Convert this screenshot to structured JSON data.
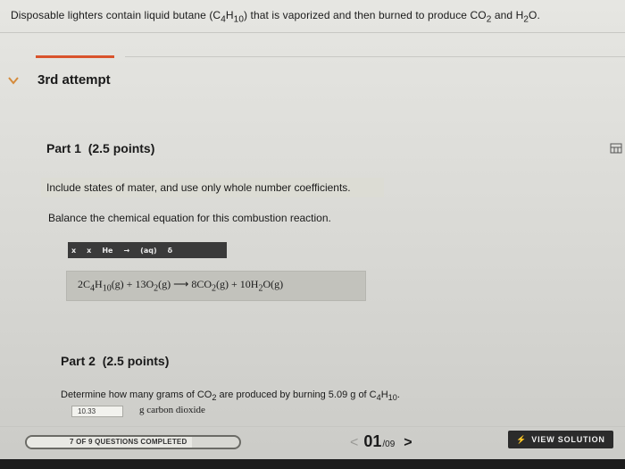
{
  "question": {
    "pre": "Disposable lighters contain liquid butane (C",
    "sub1": "4",
    "mid1": "H",
    "sub2": "10",
    "mid2": ") that is vaporized and then burned to produce CO",
    "sub3": "2",
    "mid3": " and H",
    "sub4": "2",
    "post": "O."
  },
  "attempt_label": "3rd attempt",
  "part1": {
    "title": "Part 1",
    "points": "(2.5 points)",
    "hint": "Include states of mater, and use only whole number coefficients.",
    "instruction": "Balance the chemical equation for this combustion reaction.",
    "toolbar": [
      "x",
      "x",
      "He",
      "→",
      "(aq)",
      "δ"
    ],
    "equation": {
      "t1": "2C",
      "s1": "4",
      "t2": "H",
      "s2": "10",
      "t3": "(g) + 13O",
      "s3": "2",
      "t4": "(g)  ⟶  8CO",
      "s4": "2",
      "t5": "(g) + 10H",
      "s5": "2",
      "t6": "O(g)"
    }
  },
  "part2": {
    "title": "Part 2",
    "points": "(2.5 points)",
    "q_pre": "Determine how many grams of CO",
    "q_sub": "2",
    "q_mid": " are produced by burning 5.09 g of C",
    "q_sub2": "4",
    "q_mid2": "H",
    "q_sub3": "10",
    "q_post": ".",
    "answer_value": "10.33",
    "unit": "g carbon dioxide"
  },
  "footer": {
    "progress_label": "7 OF 9 QUESTIONS COMPLETED",
    "progress_fraction": 0.778,
    "page_prev": "<",
    "page_current": "01",
    "page_total": "/09",
    "page_next": ">",
    "view_solution": "VIEW SOLUTION"
  },
  "icons": {
    "chevron": "chevron-down-icon",
    "calculator": "calculator-icon",
    "solution": "lightning-icon"
  },
  "colors": {
    "accent": "#d9532c",
    "chevron": "#d58a3a",
    "button_bg": "#2b2b2b",
    "hint_bg": "#dcdcd4"
  }
}
